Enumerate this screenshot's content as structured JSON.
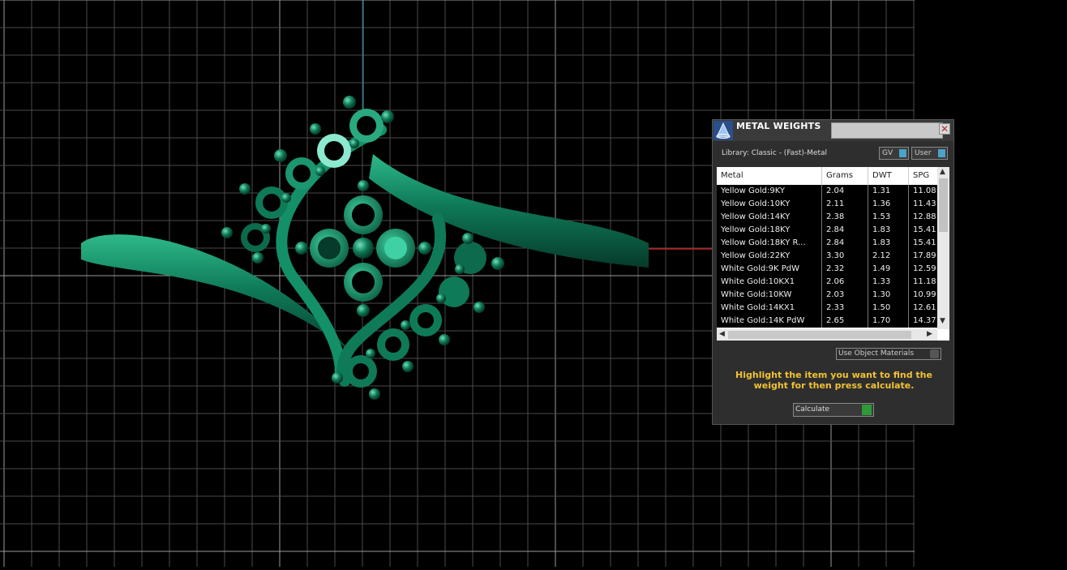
{
  "panel": {
    "title": "METAL WEIGHTS",
    "close_glyph": "✕",
    "library_label": "Library: Classic - (Fast)-Metal",
    "toggles": [
      {
        "label": "GV"
      },
      {
        "label": "User"
      }
    ],
    "columns": [
      "Metal",
      "Grams",
      "DWT",
      "SPG"
    ],
    "rows": [
      {
        "metal": "Yellow Gold:9KY",
        "grams": "2.04",
        "dwt": "1.31",
        "spg": "11.08"
      },
      {
        "metal": "Yellow Gold:10KY",
        "grams": "2.11",
        "dwt": "1.36",
        "spg": "11.43"
      },
      {
        "metal": "Yellow Gold:14KY",
        "grams": "2.38",
        "dwt": "1.53",
        "spg": "12.88"
      },
      {
        "metal": "Yellow Gold:18KY",
        "grams": "2.84",
        "dwt": "1.83",
        "spg": "15.41"
      },
      {
        "metal": "Yellow Gold:18KY R...",
        "grams": "2.84",
        "dwt": "1.83",
        "spg": "15.41"
      },
      {
        "metal": "Yellow Gold:22KY",
        "grams": "3.30",
        "dwt": "2.12",
        "spg": "17.89"
      },
      {
        "metal": "White Gold:9K PdW",
        "grams": "2.32",
        "dwt": "1.49",
        "spg": "12.59"
      },
      {
        "metal": "White Gold:10KX1",
        "grams": "2.06",
        "dwt": "1.33",
        "spg": "11.18"
      },
      {
        "metal": "White Gold:10KW",
        "grams": "2.03",
        "dwt": "1.30",
        "spg": "10.99"
      },
      {
        "metal": "White Gold:14KX1",
        "grams": "2.33",
        "dwt": "1.50",
        "spg": "12.61"
      },
      {
        "metal": "White Gold:14K PdW",
        "grams": "2.65",
        "dwt": "1.70",
        "spg": "14.37"
      }
    ],
    "use_object_materials": "Use Object Materials",
    "hint": "Highlight the item you want to find the weight for then press calculate.",
    "calculate": "Calculate"
  },
  "colors": {
    "viewport_bg": "#000000",
    "grid": "#6a6a6a",
    "ring_green": "#0f7a58",
    "hint_yellow": "#f2c232",
    "x_axis": "#c0211b",
    "y_axis": "#3a9bbd"
  }
}
